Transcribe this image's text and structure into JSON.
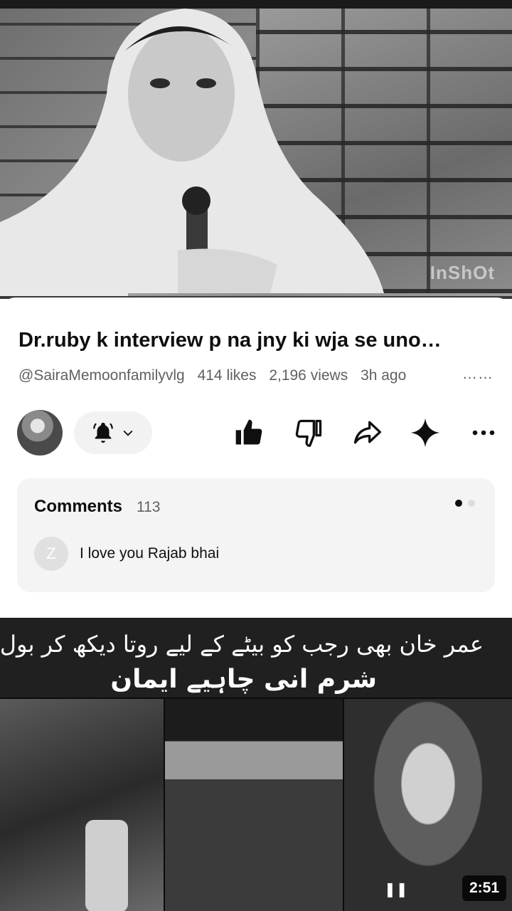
{
  "player": {
    "watermark": "InShOt",
    "progress": 0.25
  },
  "video": {
    "title": "Dr.ruby k interview p na jny ki wja se uno…",
    "channel": "@SairaMemoonfamilyvlg",
    "likes": "414 likes",
    "views": "2,196 views",
    "age": "3h ago",
    "more": "……"
  },
  "actions": {
    "icons": [
      "bell-icon",
      "chevron-down-icon",
      "like-icon",
      "dislike-icon",
      "share-icon",
      "sparkle-icon",
      "more-icon"
    ]
  },
  "comments": {
    "heading": "Comments",
    "count": "113",
    "top_comment": {
      "avatar_letter": "Z",
      "text": "I love you Rajab bhai"
    }
  },
  "next_video": {
    "caption_line1": "عمر خان بھی رجب کو بیٹے کے لیے روتا دیکھ کر بول پڑی",
    "caption_line2": "شرم انی چاہیے ایمان",
    "duration": "2:51"
  },
  "colors": {
    "text_primary": "#0f0f0f",
    "text_secondary": "#606060",
    "comment_bg": "#f4f4f4"
  }
}
